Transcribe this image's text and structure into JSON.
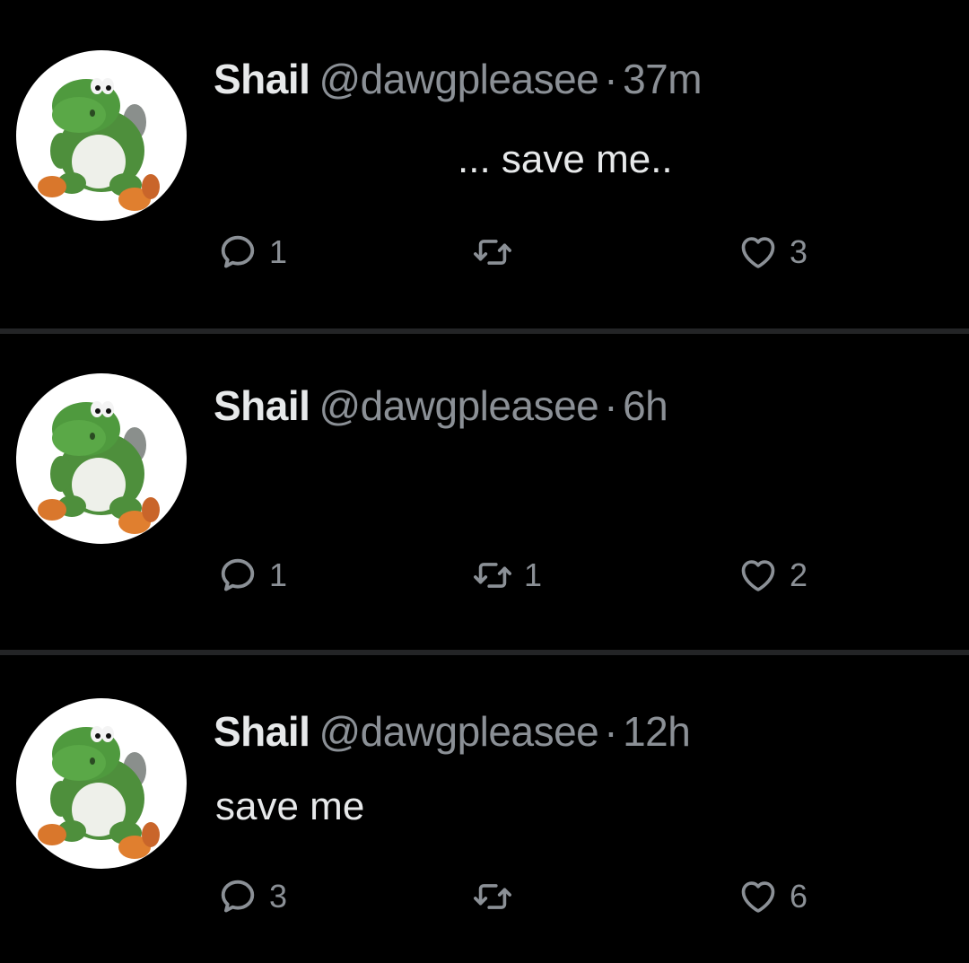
{
  "tweets": [
    {
      "display_name": "Shail",
      "handle": "@dawgpleasee",
      "separator": "·",
      "time": "37m",
      "text": "... save me..",
      "reply_count": "1",
      "retweet_count": "",
      "like_count": "3",
      "avatar_icon": "yoshi-avatar"
    },
    {
      "display_name": "Shail",
      "handle": "@dawgpleasee",
      "separator": "·",
      "time": "6h",
      "text": "",
      "reply_count": "1",
      "retweet_count": "1",
      "like_count": "2",
      "avatar_icon": "yoshi-avatar"
    },
    {
      "display_name": "Shail",
      "handle": "@dawgpleasee",
      "separator": "·",
      "time": "12h",
      "text": "save me",
      "reply_count": "3",
      "retweet_count": "",
      "like_count": "6",
      "avatar_icon": "yoshi-avatar"
    }
  ],
  "icons": {
    "reply": "reply-icon",
    "retweet": "retweet-icon",
    "like": "heart-icon"
  },
  "colors": {
    "background": "#000000",
    "text": "#e7e9ea",
    "muted": "#8b9096",
    "divider": "#232426"
  }
}
